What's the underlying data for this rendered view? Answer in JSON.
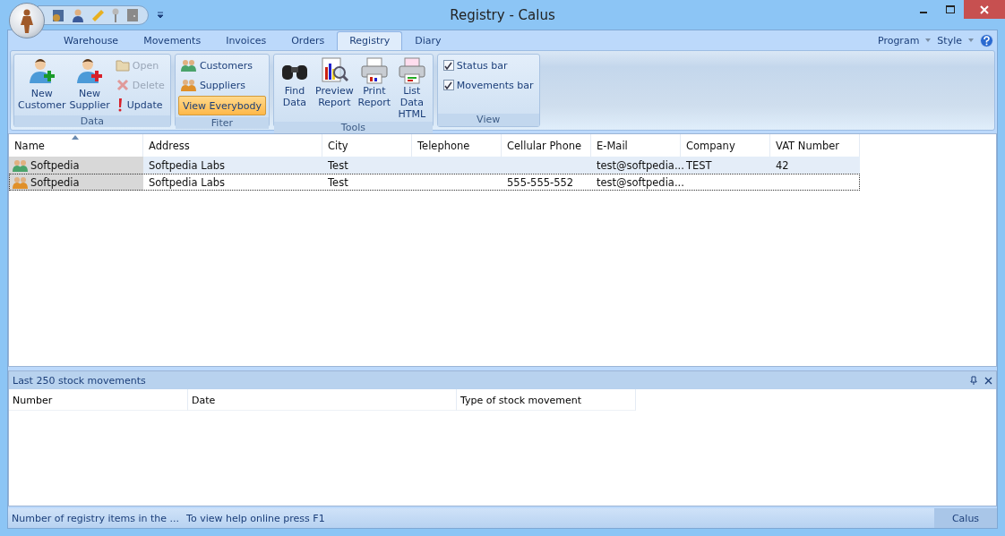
{
  "window": {
    "title": "Registry - Calus"
  },
  "tabs": [
    {
      "label": "Warehouse",
      "selected": false
    },
    {
      "label": "Movements",
      "selected": false
    },
    {
      "label": "Invoices",
      "selected": false
    },
    {
      "label": "Orders",
      "selected": false
    },
    {
      "label": "Registry",
      "selected": true
    },
    {
      "label": "Diary",
      "selected": false
    }
  ],
  "menu_right": [
    "Program",
    "Style"
  ],
  "ribbon": {
    "groups": [
      {
        "label": "Data",
        "items": [
          {
            "kind": "large",
            "label": "New Customer"
          },
          {
            "kind": "large",
            "label": "New Supplier"
          },
          {
            "kind": "small",
            "label": "Open",
            "disabled": true
          },
          {
            "kind": "small",
            "label": "Delete",
            "disabled": true
          },
          {
            "kind": "small",
            "label": "Update",
            "disabled": false
          }
        ]
      },
      {
        "label": "Fiter",
        "items": [
          {
            "kind": "small",
            "label": "Customers",
            "disabled": false
          },
          {
            "kind": "small",
            "label": "Suppliers",
            "disabled": false
          },
          {
            "kind": "toggle",
            "label": "View Everybody",
            "selected": true
          }
        ]
      },
      {
        "label": "Tools",
        "items": [
          {
            "kind": "large",
            "label": "Find Data"
          },
          {
            "kind": "large",
            "label": "Preview Report"
          },
          {
            "kind": "large",
            "label": "Print Report"
          },
          {
            "kind": "large",
            "label": "List Data HTML"
          }
        ]
      },
      {
        "label": "View",
        "items": [
          {
            "kind": "check",
            "label": "Status bar",
            "checked": true
          },
          {
            "kind": "check",
            "label": "Movements bar",
            "checked": true
          }
        ]
      }
    ]
  },
  "registry": {
    "columns": [
      "Name",
      "Address",
      "City",
      "Telephone",
      "Cellular Phone",
      "E-Mail",
      "Company",
      "VAT Number"
    ],
    "rows": [
      {
        "selected": true,
        "focused": false,
        "cells": [
          "Softpedia",
          "Softpedia Labs",
          "Test",
          "",
          "",
          "test@softpedia...",
          "TEST",
          "42"
        ]
      },
      {
        "selected": false,
        "focused": true,
        "cells": [
          "Softpedia",
          "Softpedia Labs",
          "Test",
          "",
          "555-555-552",
          "test@softpedia...",
          "",
          ""
        ]
      }
    ]
  },
  "movements_panel": {
    "title": "Last 250 stock movements",
    "columns": [
      "Number",
      "Date",
      "Type of stock movement"
    ]
  },
  "status_bar": {
    "items": [
      "Number of registry items in the ...",
      "To view help online press F1"
    ],
    "app": "Calus"
  }
}
